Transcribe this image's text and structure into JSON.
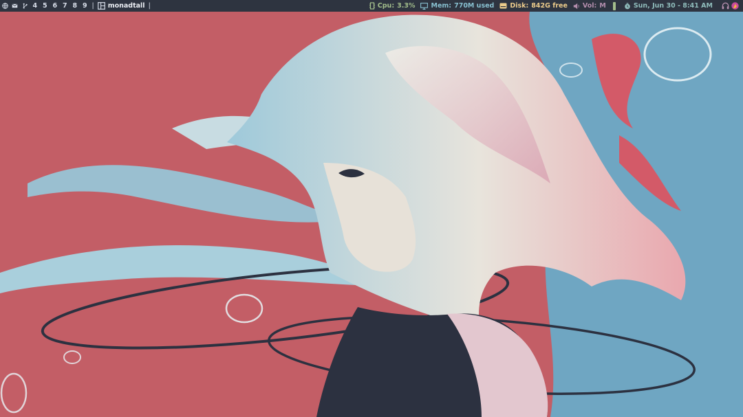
{
  "bar": {
    "workspaces": [
      {
        "label": "",
        "icon": "globe-icon"
      },
      {
        "label": "",
        "icon": "mail-icon"
      },
      {
        "label": "",
        "icon": "git-branch-icon"
      },
      {
        "label": "4"
      },
      {
        "label": "5"
      },
      {
        "label": "6"
      },
      {
        "label": "7"
      },
      {
        "label": "8"
      },
      {
        "label": "9"
      }
    ],
    "separator": "|",
    "layout_name": "monadtall",
    "widgets": {
      "cpu": {
        "label": "Cpu:",
        "value": "3.3%",
        "color": "#a3be8c"
      },
      "mem": {
        "label": "Mem:",
        "value": "770M used",
        "color": "#88c0d0"
      },
      "disk": {
        "label": "Disk:",
        "value": "842G free",
        "color": "#ebcb8b"
      },
      "vol": {
        "label": "Vol:",
        "value": "M",
        "color": "#b48ead"
      },
      "clock": {
        "value": "Sun, Jun 30 - 8:41 AM",
        "color": "#8fbcbb"
      }
    },
    "tray": [
      "headphones-icon",
      "app-indicator-icon"
    ],
    "background": "#2e3440"
  },
  "wallpaper": {
    "left_color": "#c35e66",
    "right_color": "#6fa6c2",
    "ink_color": "#2c3140"
  }
}
